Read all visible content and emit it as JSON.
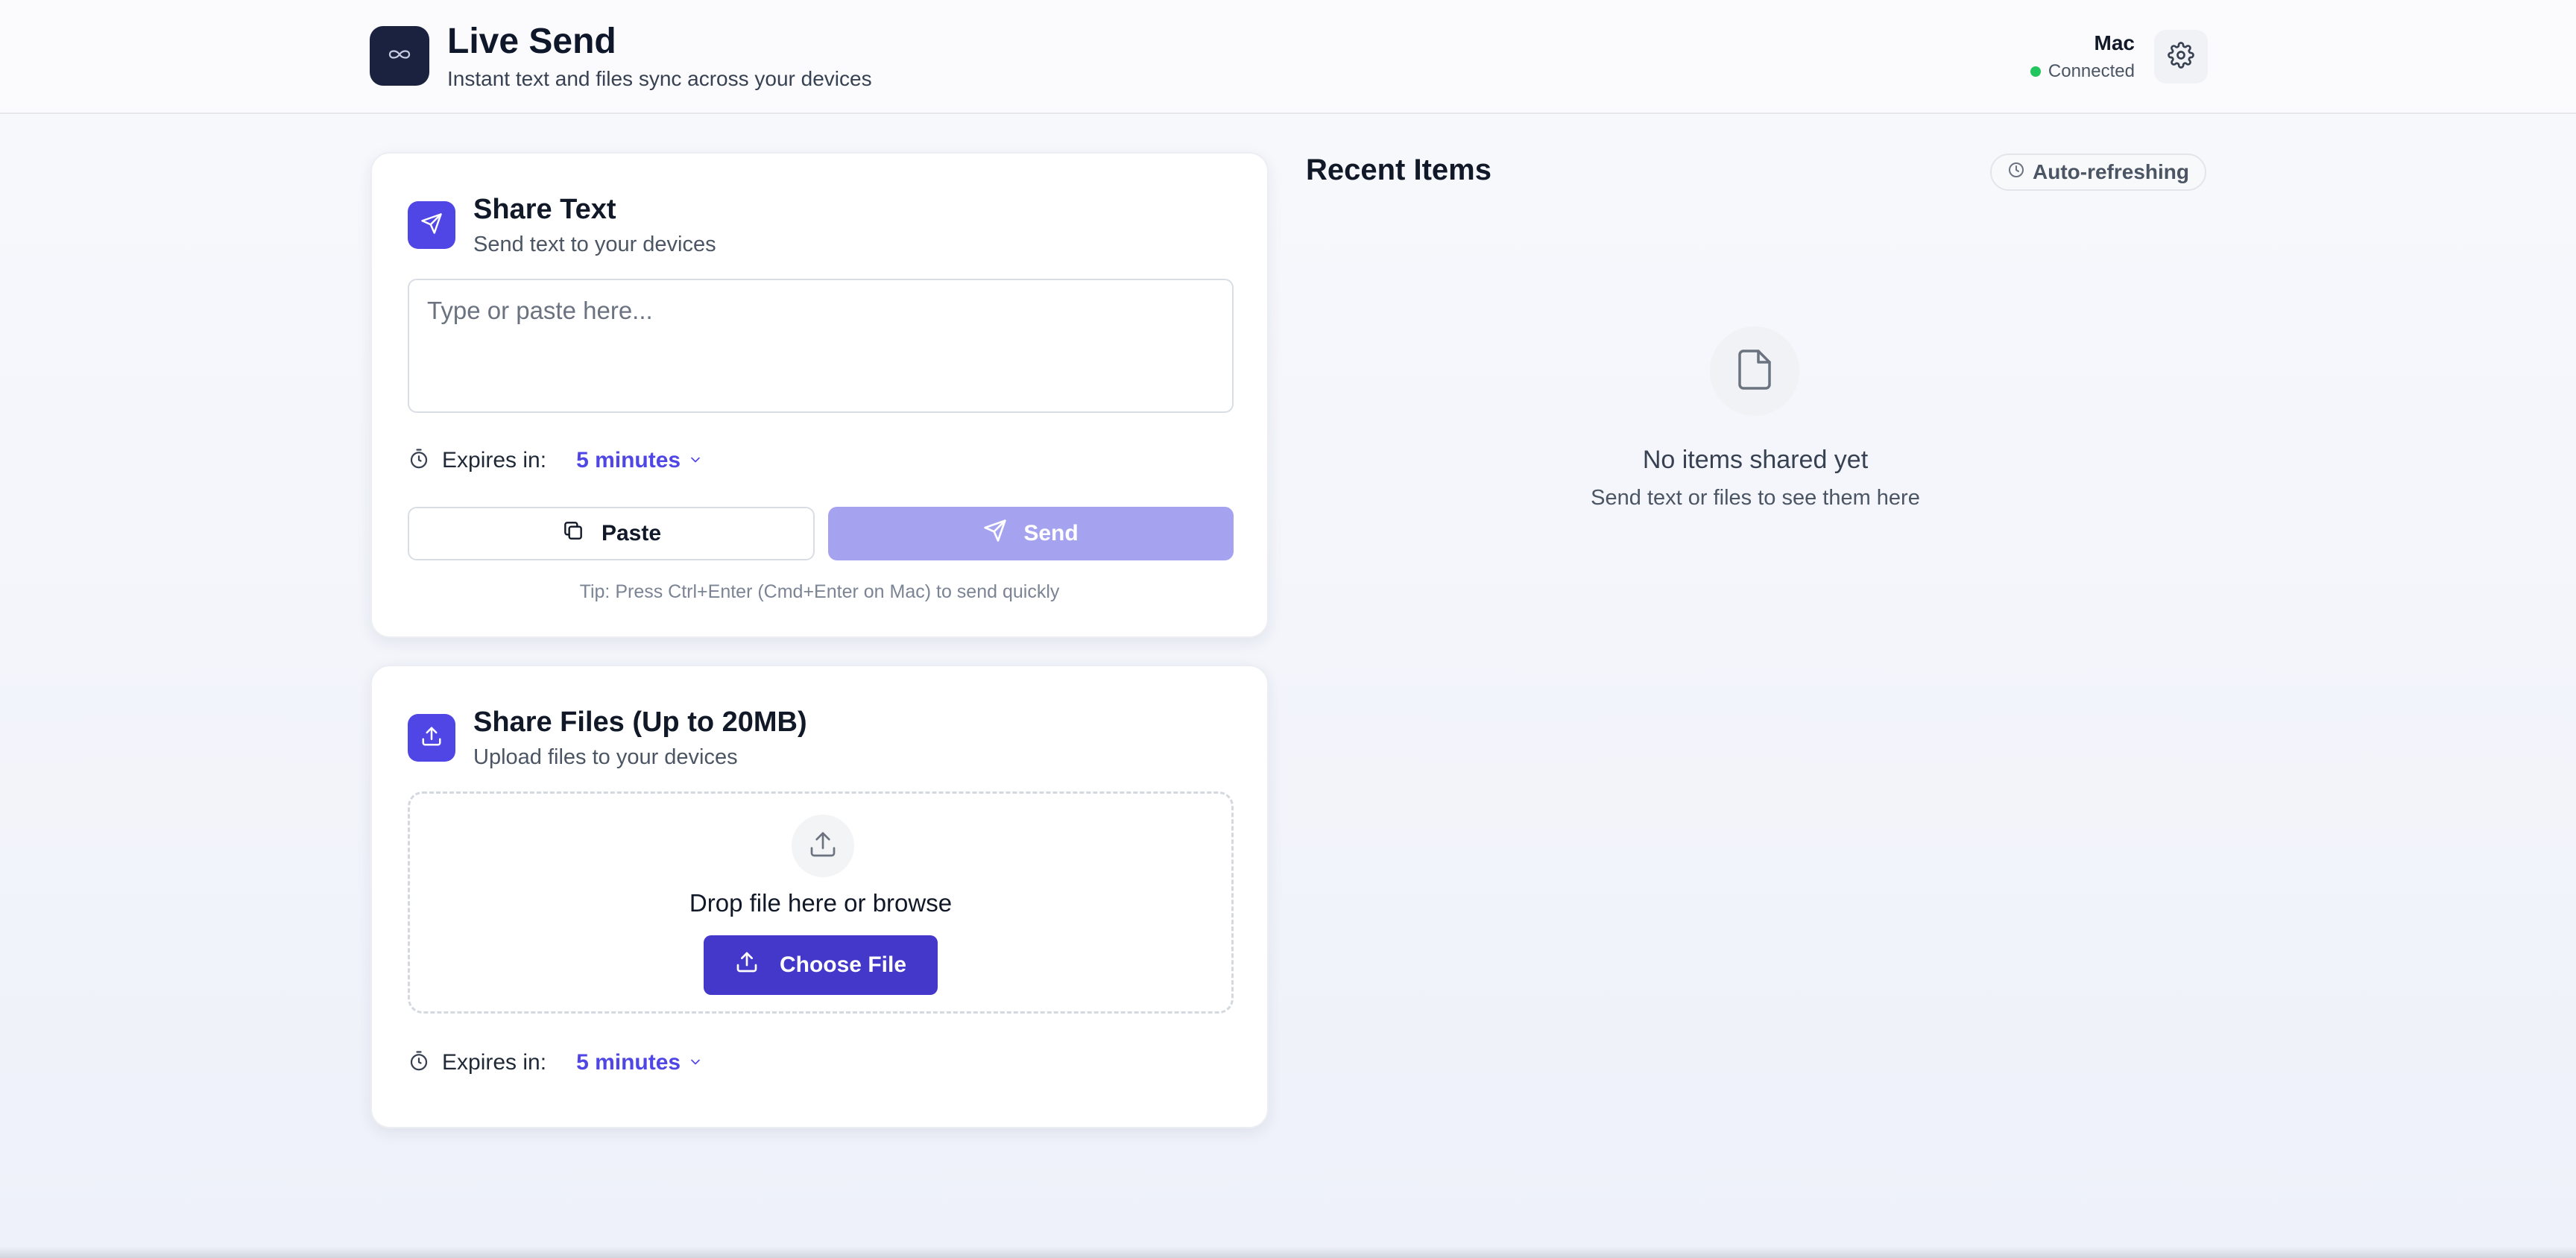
{
  "header": {
    "title": "Live Send",
    "subtitle": "Instant text and files sync across your devices",
    "device_name": "Mac",
    "status": "Connected",
    "logo_icon": "infinity-icon",
    "settings_icon": "gear-icon"
  },
  "share_text": {
    "title": "Share Text",
    "subtitle": "Send text to your devices",
    "placeholder": "Type or paste here...",
    "expires_label": "Expires in:",
    "expires_value": "5 minutes",
    "paste_label": "Paste",
    "send_label": "Send",
    "tip": "Tip: Press Ctrl+Enter (Cmd+Enter on Mac) to send quickly"
  },
  "share_files": {
    "title": "Share Files (Up to 20MB)",
    "subtitle": "Upload files to your devices",
    "drop_text": "Drop file here or browse",
    "choose_label": "Choose File",
    "expires_label": "Expires in:",
    "expires_value": "5 minutes"
  },
  "recent": {
    "title": "Recent Items",
    "badge": "Auto-refreshing",
    "empty_title": "No items shared yet",
    "empty_subtitle": "Send text or files to see them here"
  },
  "colors": {
    "accent": "#4f46e5",
    "accent_disabled": "#a5a3f0",
    "status_green": "#22c55e",
    "logo_bg": "#1a2240"
  }
}
